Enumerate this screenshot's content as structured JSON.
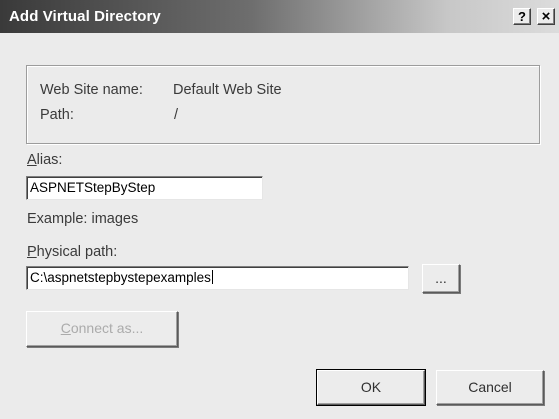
{
  "window": {
    "title": "Add Virtual Directory",
    "help_glyph": "?",
    "close_glyph": "×"
  },
  "info": {
    "site_label": "Web Site name:",
    "site_value": "Default Web Site",
    "path_label": "Path:",
    "path_value": "/"
  },
  "alias": {
    "label_accel": "A",
    "label_rest": "lias:",
    "value": "ASPNETStepByStep",
    "example": "Example: images"
  },
  "physical_path": {
    "label_accel": "P",
    "label_rest": "hysical path:",
    "value": "C:\\aspnetstepbystepexamples",
    "browse_label": "..."
  },
  "buttons": {
    "connect_accel": "C",
    "connect_rest": "onnect as...",
    "ok": "OK",
    "cancel": "Cancel"
  },
  "colors": {
    "dialog_bg": "#ebebeb",
    "title_text": "#ffffff",
    "disabled_text": "#ababab"
  }
}
